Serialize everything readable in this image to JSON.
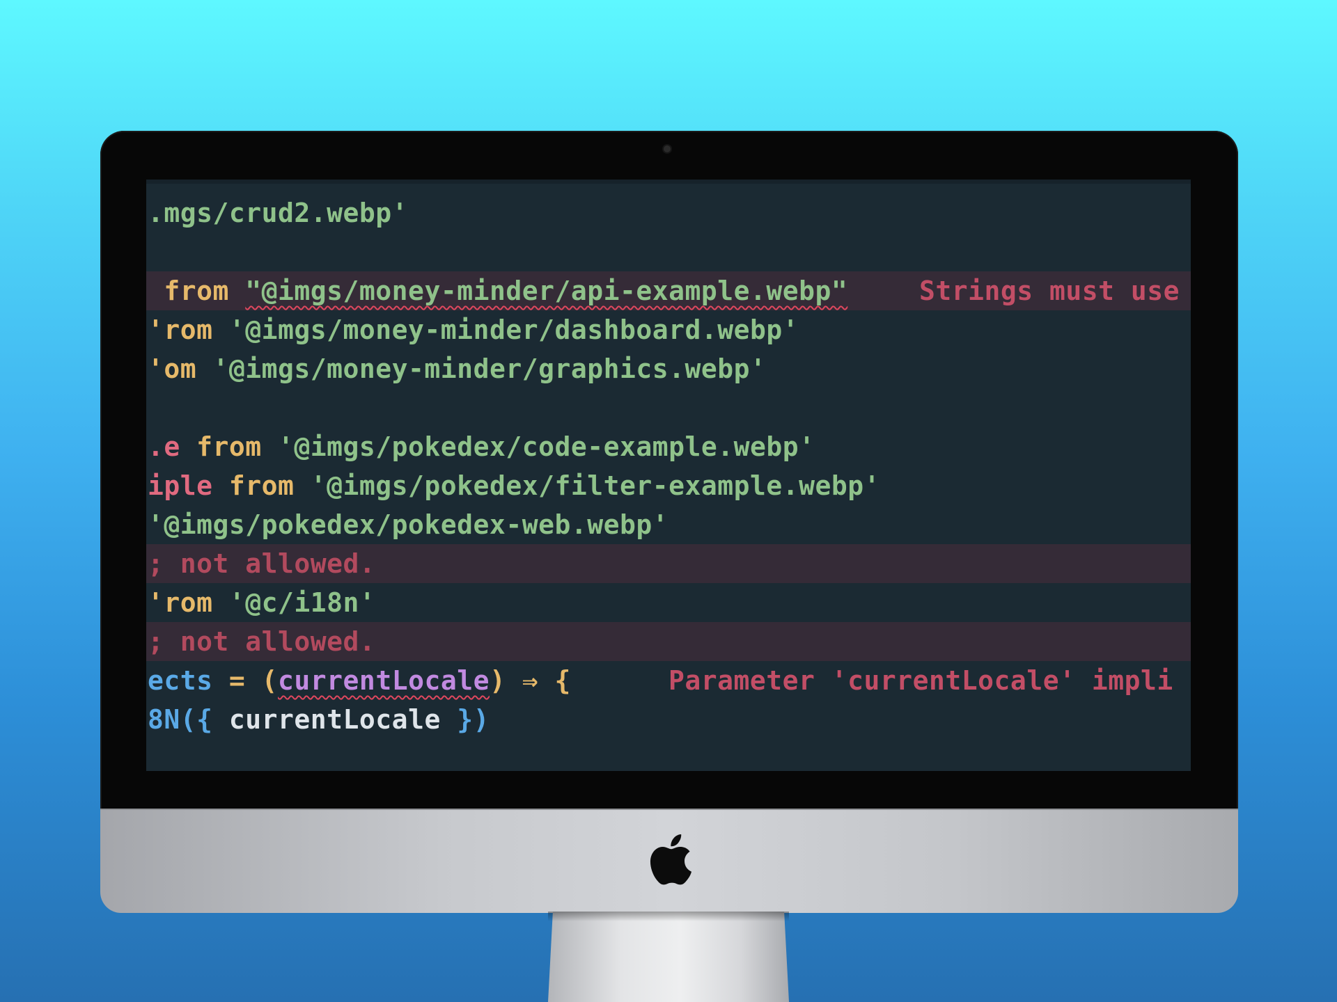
{
  "editor": {
    "lines": [
      {
        "tokens": [
          {
            "t": ".mgs/crud2.webp'",
            "c": "str"
          }
        ]
      },
      {
        "tokens": []
      },
      {
        "err": true,
        "tokens": [
          {
            "t": " from ",
            "c": "kw"
          },
          {
            "t": "\"@imgs/money-minder/api-example.webp\"",
            "c": "str",
            "sq": true
          }
        ],
        "msg": "Strings must use"
      },
      {
        "tokens": [
          {
            "t": "'rom ",
            "c": "kw"
          },
          {
            "t": "'@imgs/money-minder/dashboard.webp'",
            "c": "str"
          }
        ]
      },
      {
        "tokens": [
          {
            "t": "'om ",
            "c": "kw"
          },
          {
            "t": "'@imgs/money-minder/graphics.webp'",
            "c": "str"
          }
        ]
      },
      {
        "tokens": []
      },
      {
        "tokens": [
          {
            "t": ".e ",
            "c": "var"
          },
          {
            "t": "from ",
            "c": "kw"
          },
          {
            "t": "'@imgs/pokedex/code-example.webp'",
            "c": "str"
          }
        ]
      },
      {
        "tokens": [
          {
            "t": "iple ",
            "c": "var"
          },
          {
            "t": "from ",
            "c": "kw"
          },
          {
            "t": "'@imgs/pokedex/filter-example.webp'",
            "c": "str"
          }
        ]
      },
      {
        "tokens": [
          {
            "t": "'@imgs/pokedex/pokedex-web.webp'",
            "c": "str"
          }
        ]
      },
      {
        "err": true,
        "tokens": [
          {
            "t": "; not allowed.",
            "c": "errdim"
          }
        ]
      },
      {
        "tokens": [
          {
            "t": "'rom ",
            "c": "kw"
          },
          {
            "t": "'@c/i18n'",
            "c": "str"
          }
        ]
      },
      {
        "err": true,
        "tokens": [
          {
            "t": "; not allowed.",
            "c": "errdim"
          }
        ]
      },
      {
        "tokens": [
          {
            "t": "ects ",
            "c": "fn"
          },
          {
            "t": "= ",
            "c": "op"
          },
          {
            "t": "(",
            "c": "op"
          },
          {
            "t": "currentLocale",
            "c": "param",
            "sq": true
          },
          {
            "t": ") ",
            "c": "op"
          },
          {
            "t": "⇒ ",
            "c": "op"
          },
          {
            "t": "{",
            "c": "op"
          }
        ],
        "msg": "Parameter 'currentLocale' impli"
      },
      {
        "tokens": [
          {
            "t": "8N",
            "c": "fn"
          },
          {
            "t": "({ ",
            "c": "brace"
          },
          {
            "t": "currentLocale ",
            "c": "id"
          },
          {
            "t": "})",
            "c": "brace"
          }
        ]
      }
    ]
  },
  "device": {
    "logo": "apple-logo",
    "camera": "camera"
  }
}
